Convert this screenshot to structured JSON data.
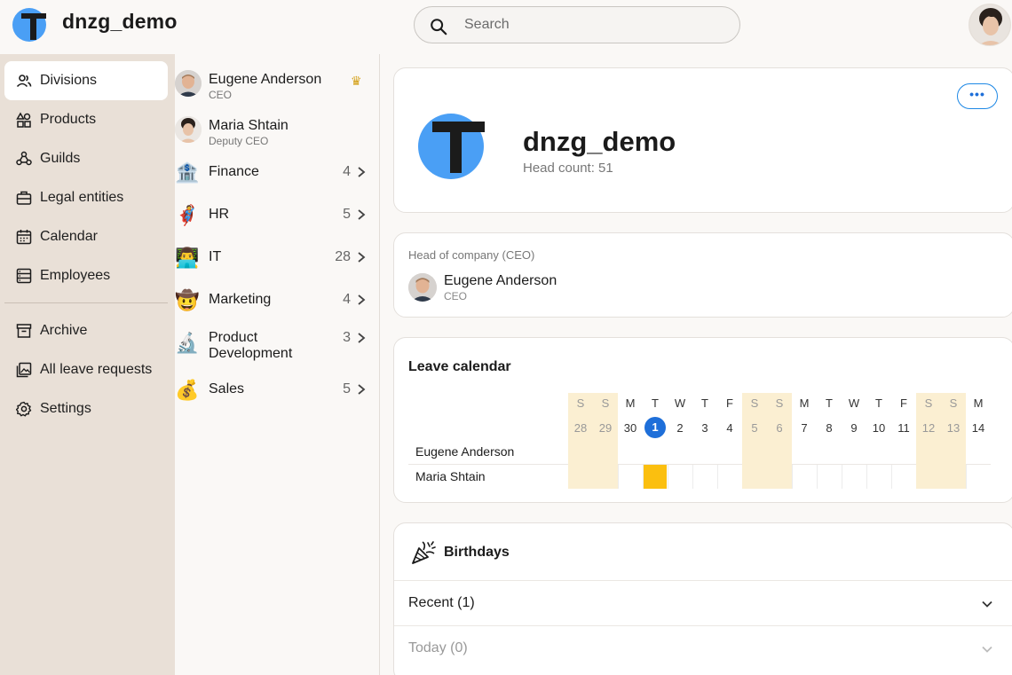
{
  "header": {
    "app_title": "dnzg_demo",
    "search_placeholder": "Search"
  },
  "sidebar": {
    "items": [
      {
        "label": "Divisions",
        "icon": "people-icon",
        "active": true
      },
      {
        "label": "Products",
        "icon": "shapes-icon"
      },
      {
        "label": "Guilds",
        "icon": "guild-icon"
      },
      {
        "label": "Legal entities",
        "icon": "briefcase-icon"
      },
      {
        "label": "Calendar",
        "icon": "calendar-icon"
      },
      {
        "label": "Employees",
        "icon": "list-icon"
      }
    ],
    "secondary_items": [
      {
        "label": "Archive",
        "icon": "archive-icon"
      },
      {
        "label": "All leave requests",
        "icon": "gallery-icon"
      },
      {
        "label": "Settings",
        "icon": "gear-icon"
      }
    ]
  },
  "leaders": [
    {
      "name": "Eugene Anderson",
      "role": "CEO",
      "crown": "♛"
    },
    {
      "name": "Maria Shtain",
      "role": "Deputy CEO"
    }
  ],
  "divisions": [
    {
      "name": "Finance",
      "count": "4",
      "emoji": "🏦"
    },
    {
      "name": "HR",
      "count": "5",
      "emoji": "🦸"
    },
    {
      "name": "IT",
      "count": "28",
      "emoji": "👨‍💻"
    },
    {
      "name": "Marketing",
      "count": "4",
      "emoji": "🤠"
    },
    {
      "name": "Product Development",
      "count": "3",
      "emoji": "🔬"
    },
    {
      "name": "Sales",
      "count": "5",
      "emoji": "💰"
    }
  ],
  "company": {
    "name": "dnzg_demo",
    "headcount": "Head count: 51",
    "more_label": "•••"
  },
  "ceo_card": {
    "heading": "Head of company (CEO)",
    "name": "Eugene Anderson",
    "role": "CEO"
  },
  "leave_calendar": {
    "title": "Leave calendar",
    "days": [
      {
        "dow": "S",
        "day": "28",
        "weekend": true
      },
      {
        "dow": "S",
        "day": "29",
        "weekend": true
      },
      {
        "dow": "M",
        "day": "30"
      },
      {
        "dow": "T",
        "day": "1",
        "today": true
      },
      {
        "dow": "W",
        "day": "2"
      },
      {
        "dow": "T",
        "day": "3"
      },
      {
        "dow": "F",
        "day": "4"
      },
      {
        "dow": "S",
        "day": "5",
        "weekend": true
      },
      {
        "dow": "S",
        "day": "6",
        "weekend": true
      },
      {
        "dow": "M",
        "day": "7"
      },
      {
        "dow": "T",
        "day": "8"
      },
      {
        "dow": "W",
        "day": "9"
      },
      {
        "dow": "T",
        "day": "10"
      },
      {
        "dow": "F",
        "day": "11"
      },
      {
        "dow": "S",
        "day": "12",
        "weekend": true
      },
      {
        "dow": "S",
        "day": "13",
        "weekend": true
      },
      {
        "dow": "M",
        "day": "14"
      }
    ],
    "people": [
      "Eugene Anderson",
      "Maria Shtain"
    ],
    "leave_days": {
      "Maria Shtain": [
        "1"
      ]
    },
    "colors": {
      "weekend": "#fbefd2",
      "leave": "#fbbf0f",
      "today": "#1e6fd9"
    }
  },
  "birthdays": {
    "title": "Birthdays",
    "sections": [
      {
        "label": "Recent (1)",
        "muted": false
      },
      {
        "label": "Today (0)",
        "muted": true
      }
    ]
  },
  "colors": {
    "accent": "#1e6fd9",
    "sidebar_bg": "#e9e0d7",
    "logo_blue": "#4a9ff5"
  }
}
